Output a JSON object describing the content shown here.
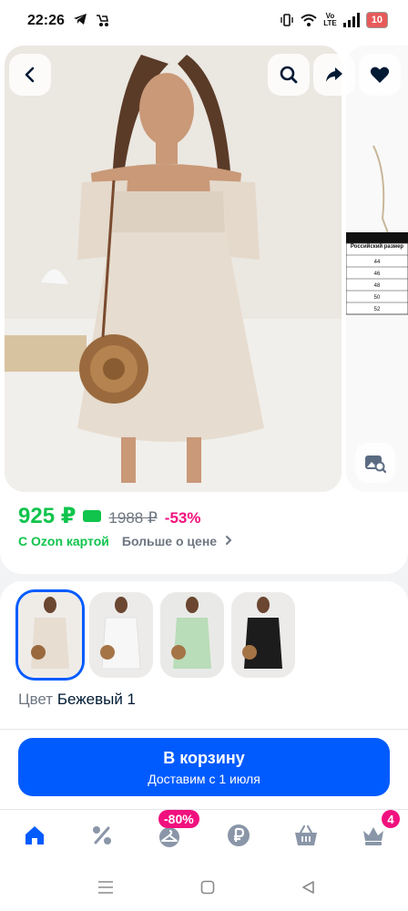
{
  "status_bar": {
    "time": "22:26",
    "battery": "10",
    "network": "Vo\nLTE"
  },
  "gallery": {
    "size_table_title": "Российский размер",
    "sizes": [
      "44",
      "46",
      "48",
      "50",
      "52"
    ]
  },
  "price": {
    "current": "925 ₽",
    "old": "1988 ₽",
    "discount": "-53%",
    "ozon_card": "С Ozon картой",
    "more_about_price": "Больше о цене"
  },
  "variants": {
    "thumb_colors": [
      "#e7ddd1",
      "#f4f4f4",
      "#b9dcb9",
      "#1c1c1c"
    ],
    "color_label": "Цвет",
    "color_value": "Бежевый 1"
  },
  "cart": {
    "title": "В корзину",
    "subtitle": "Доставим с 1 июля"
  },
  "bottom_nav": {
    "sale_badge": "-80%",
    "cart_count": "4",
    "accent": "#005bff",
    "icon_color": "#8a96a8"
  },
  "colors": {
    "accent": "#005bff",
    "price_green": "#10c44c",
    "discount_pink": "#f1117e"
  }
}
